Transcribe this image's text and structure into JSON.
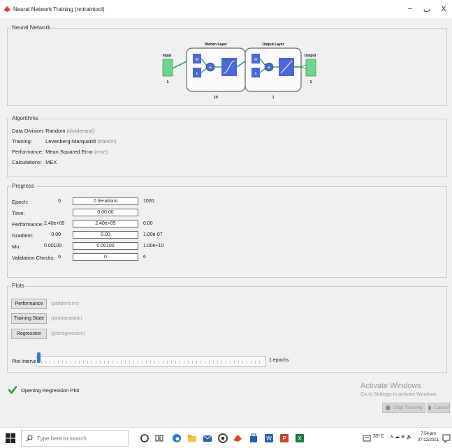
{
  "window": {
    "title": "Neural Network Training (nntraintool)",
    "minimize_glyph": "−",
    "restore_glyph": "ٮ",
    "close_glyph": "X"
  },
  "network": {
    "section_title": "Neural Network",
    "input_label": "Input",
    "input_size": "1",
    "hidden_label": "Hidden Layer",
    "hidden_size": "10",
    "output_layer_label": "Output Layer",
    "output_layer_size": "1",
    "output_label": "Output",
    "output_size": "1",
    "weight_symbol": "W",
    "bias_symbol": "b",
    "sum_symbol": "+"
  },
  "algorithms": {
    "section_title": "Algorithms",
    "rows": [
      {
        "key": "Data Division:",
        "value": "Random",
        "fn": "(dividerand)"
      },
      {
        "key": "Training:",
        "value": "Levenberg-Marquardt",
        "fn": "(trainlm)"
      },
      {
        "key": "Performance:",
        "value": "Mean Squared Error",
        "fn": "(mse)"
      },
      {
        "key": "Calculations:",
        "value": "MEX",
        "fn": ""
      }
    ]
  },
  "progress": {
    "section_title": "Progress",
    "rows": [
      {
        "label": "Epoch:",
        "start": "0",
        "current": "0 iterations",
        "end": "1000"
      },
      {
        "label": "Time:",
        "start": "",
        "current": "0:00:00",
        "end": ""
      },
      {
        "label": "Performance:",
        "start": "2.40e+05",
        "current": "2.40e+05",
        "end": "0.00"
      },
      {
        "label": "Gradient:",
        "start": "0.00",
        "current": "0.00",
        "end": "1.00e-07"
      },
      {
        "label": "Mu:",
        "start": "0.00100",
        "current": "0.00100",
        "end": "1.00e+10"
      },
      {
        "label": "Validation Checks:",
        "start": "0",
        "current": "0",
        "end": "6"
      }
    ]
  },
  "plots": {
    "section_title": "Plots",
    "buttons": [
      {
        "label": "Performance",
        "fn": "(plotperform)"
      },
      {
        "label": "Training State",
        "fn": "(plottrainstate)"
      },
      {
        "label": "Regression",
        "fn": "(plotregression)"
      }
    ],
    "interval_label": "Plot Interval:",
    "interval_unit": "1 epochs",
    "interval_fraction": 0.0
  },
  "status": {
    "message": "Opening Regression Plot"
  },
  "watermark": {
    "line1": "Activate Windows",
    "line2": "Go to Settings to activate Windows."
  },
  "actions": {
    "stop_label": "Stop Training",
    "cancel_label": "Cancel"
  },
  "taskbar": {
    "search_placeholder": "Type here to search",
    "weather": "35°C",
    "tray_glyphs": "∧ ☁ ⊕ 🔈",
    "time": "7:54 am",
    "date": "07/12/2021"
  },
  "colors": {
    "weight_box": "#4a67d6",
    "io_box": "#6ed58f",
    "link": "#1a9a55",
    "accent": "#3d76d3",
    "check": "#2e9e2e"
  }
}
